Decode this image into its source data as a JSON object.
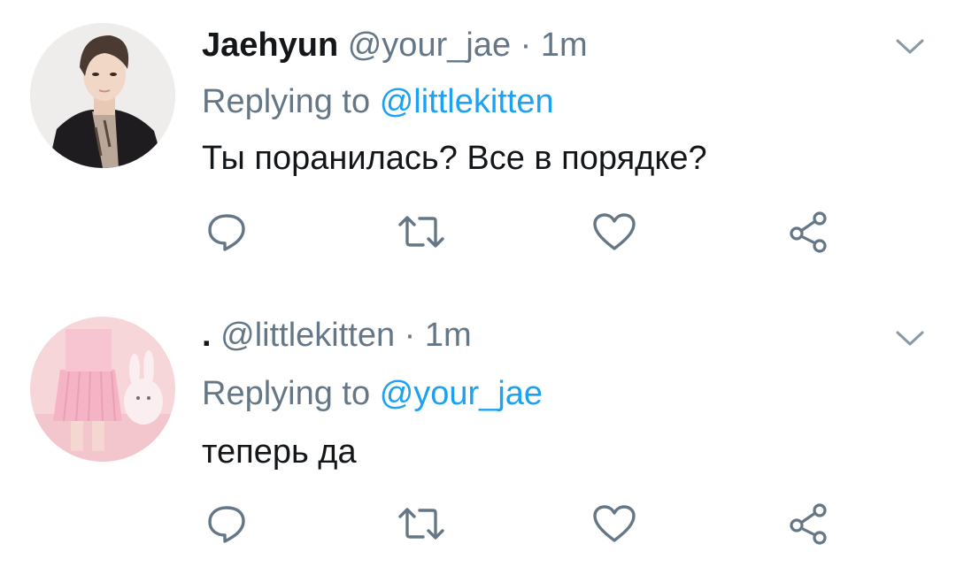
{
  "tweets": [
    {
      "display_name": "Jaehyun",
      "handle": "@your_jae",
      "separator": "·",
      "time": "1m",
      "replying_prefix": "Replying to",
      "replying_to": "@littlekitten",
      "text": "Ты поранилась? Все в порядке?"
    },
    {
      "display_name": ".",
      "handle": "@littlekitten",
      "separator": "·",
      "time": "1m",
      "replying_prefix": "Replying to",
      "replying_to": "@your_jae",
      "text": "теперь да"
    }
  ],
  "colors": {
    "text": "#14171a",
    "secondary": "#657786",
    "link": "#1da1f2",
    "icon": "#657786"
  },
  "icons": [
    "reply-icon",
    "retweet-icon",
    "like-icon",
    "share-icon",
    "chevron-down-icon"
  ]
}
